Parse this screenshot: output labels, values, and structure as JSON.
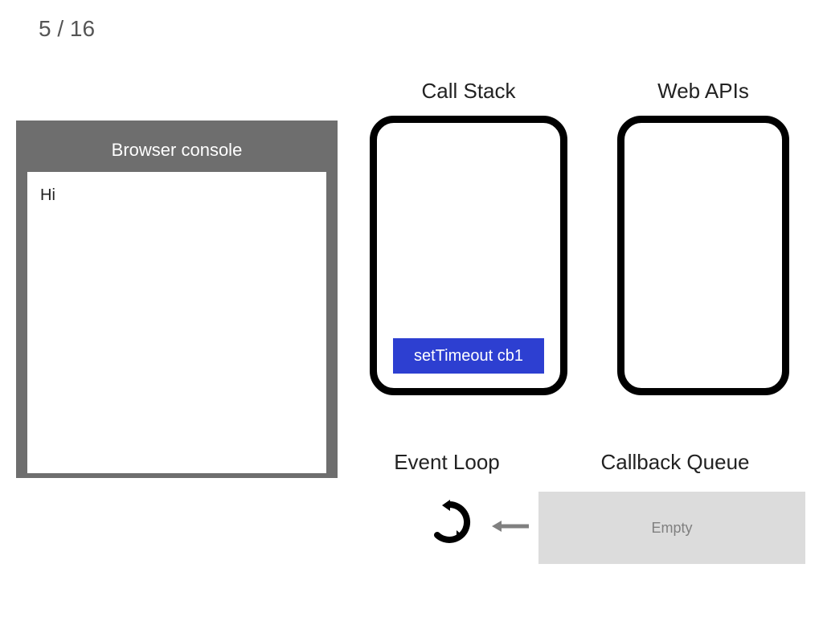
{
  "page_counter": "5 / 16",
  "browser_console": {
    "title": "Browser console",
    "output": [
      "Hi"
    ]
  },
  "call_stack": {
    "title": "Call Stack",
    "items": [
      {
        "label": "setTimeout cb1",
        "color": "#2d3fd1",
        "text_color": "#ffffff"
      }
    ]
  },
  "web_apis": {
    "title": "Web APIs",
    "items": []
  },
  "event_loop": {
    "title": "Event Loop",
    "icon": "loop-icon"
  },
  "callback_queue": {
    "title": "Callback Queue",
    "status": "Empty"
  },
  "colors": {
    "console_frame": "#6e6e6e",
    "stack_item_blue": "#2d3fd1",
    "queue_bg": "#dcdcdc"
  }
}
